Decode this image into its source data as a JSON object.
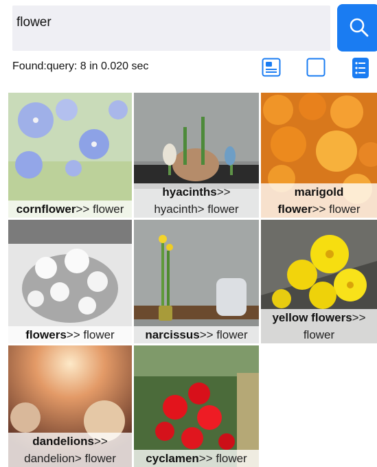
{
  "search": {
    "query": "flower"
  },
  "status": "Found:query: 8 in 0.020 sec",
  "colors": {
    "accent": "#1a7cf2"
  },
  "view_icons": [
    "card-view-icon",
    "single-view-icon",
    "list-view-icon"
  ],
  "results": [
    {
      "lines": [
        {
          "bold": "cornflower",
          "rest": ">> flower"
        }
      ]
    },
    {
      "lines": [
        {
          "bold": "hyacinths",
          "rest": ">>"
        },
        {
          "bold": "",
          "rest": "hyacinth> flower"
        }
      ]
    },
    {
      "lines": [
        {
          "bold": "marigold",
          "rest": ""
        },
        {
          "bold": "flower",
          "rest": ">> flower"
        }
      ]
    },
    {
      "lines": [
        {
          "bold": "flowers",
          "rest": ">> flower"
        }
      ]
    },
    {
      "lines": [
        {
          "bold": "narcissus",
          "rest": ">> flower"
        }
      ]
    },
    {
      "lines": [
        {
          "bold": "yellow flowers",
          "rest": ">>"
        },
        {
          "bold": "",
          "rest": "flower"
        }
      ]
    },
    {
      "lines": [
        {
          "bold": "dandelions",
          "rest": ">>"
        },
        {
          "bold": "",
          "rest": "dandelion> flower"
        }
      ]
    },
    {
      "lines": [
        {
          "bold": "cyclamen",
          "rest": ">> flower"
        }
      ]
    }
  ]
}
